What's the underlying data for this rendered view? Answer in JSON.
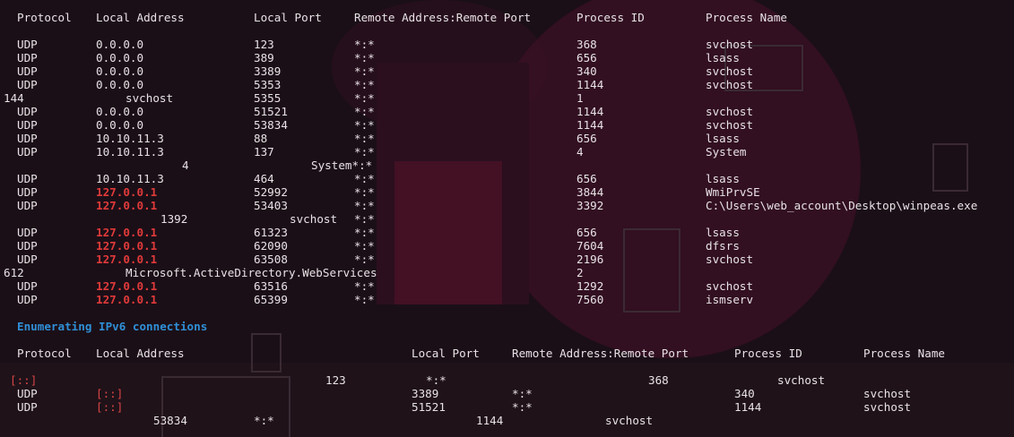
{
  "ipv4_header": {
    "protocol": "Protocol",
    "local_address": "Local Address",
    "local_port": "Local Port",
    "remote": "Remote Address:Remote Port",
    "pid": "Process ID",
    "pname": "Process Name"
  },
  "ipv4_rows": [
    {
      "proto": "UDP",
      "addr": "0.0.0.0",
      "port": "123",
      "remote": "*:*",
      "pid": "368",
      "name": "svchost"
    },
    {
      "proto": "UDP",
      "addr": "0.0.0.0",
      "port": "389",
      "remote": "*:*",
      "pid": "656",
      "name": "lsass"
    },
    {
      "proto": "UDP",
      "addr": "0.0.0.0",
      "port": "3389",
      "remote": "*:*",
      "pid": "340",
      "name": "svchost"
    },
    {
      "proto": "UDP",
      "addr": "0.0.0.0",
      "port": "5353",
      "remote": "*:*",
      "pid": "1144",
      "name": "svchost"
    },
    {
      "broken": true,
      "c1": "144",
      "c2": "svchost",
      "port": "5355",
      "remote": "*:*",
      "pid": "1"
    },
    {
      "proto": "UDP",
      "addr": "0.0.0.0",
      "port": "51521",
      "remote": "*:*",
      "pid": "1144",
      "name": "svchost"
    },
    {
      "proto": "UDP",
      "addr": "0.0.0.0",
      "port": "53834",
      "remote": "*:*",
      "pid": "1144",
      "name": "svchost"
    },
    {
      "proto": "UDP",
      "addr": "10.10.11.3",
      "port": "88",
      "remote": "*:*",
      "pid": "656",
      "name": "lsass"
    },
    {
      "proto": "UDP",
      "addr": "10.10.11.3",
      "port": "137",
      "remote": "*:*",
      "pid": "4",
      "name": "System"
    },
    {
      "broken2": true,
      "c1": "4",
      "c2": "System",
      "remote": "*:*"
    },
    {
      "proto": "UDP",
      "addr": "10.10.11.3",
      "port": "464",
      "remote": "*:*",
      "pid": "656",
      "name": "lsass"
    },
    {
      "proto": "UDP",
      "addr": "127.0.0.1",
      "local": true,
      "port": "52992",
      "remote": "*:*",
      "pid": "3844",
      "name": "WmiPrvSE"
    },
    {
      "proto": "UDP",
      "addr": "127.0.0.1",
      "local": true,
      "port": "53403",
      "remote": "*:*",
      "pid": "3392",
      "name": "C:\\Users\\web_account\\Desktop\\winpeas.exe"
    },
    {
      "broken3": true,
      "c1": "1392",
      "c2": "svchost",
      "remote": "*:*"
    },
    {
      "proto": "UDP",
      "addr": "127.0.0.1",
      "local": true,
      "port": "61323",
      "remote": "*:*",
      "pid": "656",
      "name": "lsass"
    },
    {
      "proto": "UDP",
      "addr": "127.0.0.1",
      "local": true,
      "port": "62090",
      "remote": "*:*",
      "pid": "7604",
      "name": "dfsrs"
    },
    {
      "proto": "UDP",
      "addr": "127.0.0.1",
      "local": true,
      "port": "63508",
      "remote": "*:*",
      "pid": "2196",
      "name": "svchost"
    },
    {
      "broken4": true,
      "c1": "612",
      "c2": "Microsoft.ActiveDirectory.WebServices",
      "pid": "2"
    },
    {
      "proto": "UDP",
      "addr": "127.0.0.1",
      "local": true,
      "port": "63516",
      "remote": "*:*",
      "pid": "1292",
      "name": "svchost"
    },
    {
      "proto": "UDP",
      "addr": "127.0.0.1",
      "local": true,
      "port": "65399",
      "remote": "*:*",
      "pid": "7560",
      "name": "ismserv"
    }
  ],
  "section_title": "Enumerating IPv6 connections",
  "ipv6_header": {
    "protocol": "Protocol",
    "local_address": "Local Address",
    "local_port": "Local Port",
    "remote": "Remote Address:Remote Port",
    "pid": "Process ID",
    "pname": "Process Name"
  },
  "ipv6_rows": [
    {
      "broken": true,
      "addr": "[::]",
      "port": "123",
      "remote": "*:*",
      "pid": "368",
      "name": "svchost"
    },
    {
      "proto": "UDP",
      "addr": "[::]",
      "port": "3389",
      "remote": "*:*",
      "pid": "340",
      "name": "svchost"
    },
    {
      "proto": "UDP",
      "addr": "[::]",
      "port": "51521",
      "remote": "*:*",
      "pid": "1144",
      "name": "svchost"
    },
    {
      "broken2": true,
      "port": "53834",
      "remote": "*:*",
      "pid": "1144",
      "name": "svchost"
    }
  ]
}
